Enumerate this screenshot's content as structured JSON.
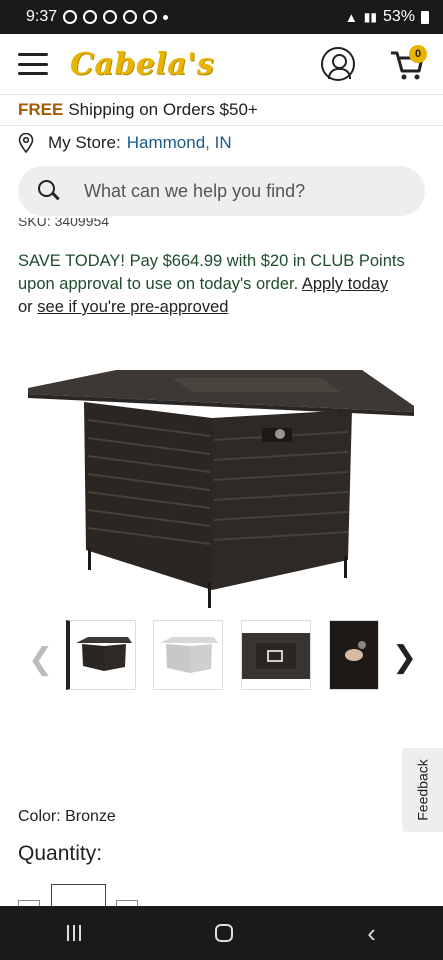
{
  "status_bar": {
    "time": "9:37",
    "battery": "53%"
  },
  "header": {
    "logo": "Cabela's",
    "cart_count": "0"
  },
  "shipping": {
    "free": "FREE",
    "text": "Shipping on Orders $50+"
  },
  "store": {
    "label": "My Store:",
    "name": "Hammond, IN"
  },
  "search": {
    "placeholder": "What can we help you find?"
  },
  "product": {
    "sku": "SKU: 3409954",
    "promo_text": "SAVE TODAY! Pay $664.99 with $20 in CLUB Points upon approval to use on today's order.",
    "apply_link": "Apply today",
    "or_text": "or",
    "preapproved_link": "see if you're pre-approved",
    "color_label": "Color: Bronze",
    "quantity_label": "Quantity:"
  },
  "feedback": {
    "label": "Feedback"
  },
  "colors": {
    "logo": "#e8b400",
    "free": "#a35a00",
    "promo": "#1f4d2b",
    "link": "#1a5a8a"
  }
}
